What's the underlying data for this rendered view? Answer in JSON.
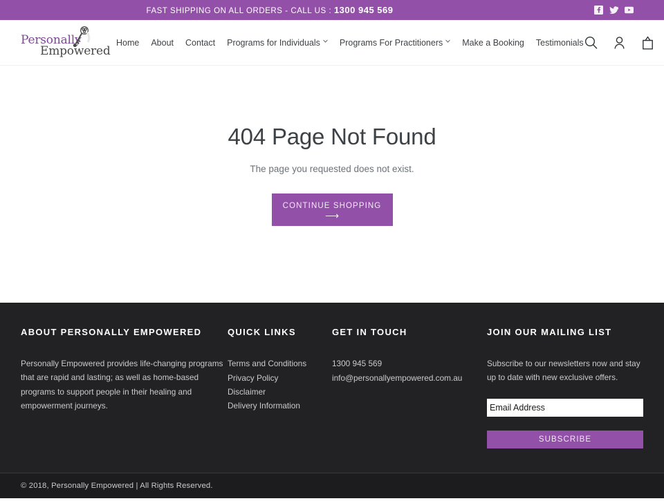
{
  "announcement": {
    "text_prefix": "FAST SHIPPING ON ALL ORDERS - CALL US : ",
    "phone": "1300 945 569",
    "social": [
      {
        "name": "facebook-icon",
        "label": "Facebook"
      },
      {
        "name": "twitter-icon",
        "label": "Twitter"
      },
      {
        "name": "youtube-icon",
        "label": "YouTube"
      }
    ]
  },
  "header": {
    "logo": {
      "line1": "Personally",
      "line2": "Empowered",
      "icon": "key-icon"
    },
    "nav": [
      {
        "label": "Home",
        "has_dropdown": false
      },
      {
        "label": "About",
        "has_dropdown": false
      },
      {
        "label": "Contact",
        "has_dropdown": false
      },
      {
        "label": "Programs for Individuals",
        "has_dropdown": true
      },
      {
        "label": "Programs For Practitioners",
        "has_dropdown": true
      },
      {
        "label": "Make a Booking",
        "has_dropdown": false
      },
      {
        "label": "Testimonials",
        "has_dropdown": false
      }
    ],
    "icons": [
      {
        "name": "search-icon",
        "label": "Search"
      },
      {
        "name": "account-icon",
        "label": "Account"
      },
      {
        "name": "cart-icon",
        "label": "Cart"
      }
    ]
  },
  "main": {
    "title": "404 Page Not Found",
    "subtitle": "The page you requested does not exist.",
    "cta_label": "CONTINUE SHOPPING",
    "cta_arrow": "⟶"
  },
  "footer": {
    "about": {
      "title": "ABOUT PERSONALLY EMPOWERED",
      "body": "Personally Empowered provides life-changing programs that are rapid and lasting; as well as home-based programs to support people in their healing and empowerment journeys."
    },
    "quick_links": {
      "title": "QUICK LINKS",
      "items": [
        "Terms and Conditions",
        "Privacy Policy",
        "Disclaimer",
        "Delivery Information"
      ]
    },
    "get_in_touch": {
      "title": "GET IN TOUCH",
      "phone": "1300 945 569",
      "email": "info@personallyempowered.com.au"
    },
    "mailing_list": {
      "title": "JOIN OUR MAILING LIST",
      "body": "Subscribe to our newsletters now and stay up to date with new exclusive offers.",
      "input_placeholder": "Email Address",
      "input_value": "",
      "button_label": "SUBSCRIBE"
    },
    "copyright": "© 2018, Personally Empowered | All Rights Reserved."
  },
  "colors": {
    "brand_purple": "#9350a8",
    "footer_dark": "#222224",
    "copy_dark": "#1c1c1e",
    "text_dark": "#3d4246",
    "logo_purple": "#7c4a95"
  }
}
